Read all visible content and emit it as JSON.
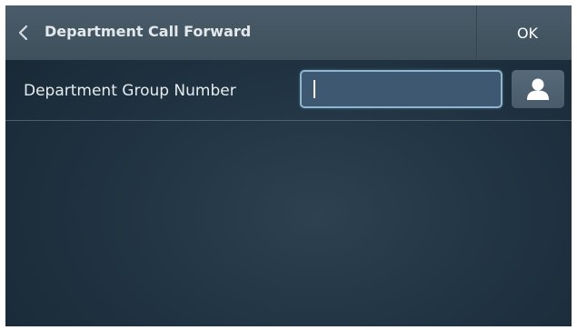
{
  "header": {
    "title": "Department Call Forward",
    "ok_label": "OK"
  },
  "form": {
    "group_number_label": "Department Group Number",
    "group_number_value": ""
  },
  "icons": {
    "back": "chevron-left-icon",
    "contact": "person-icon"
  },
  "colors": {
    "header_bg": "#45576 4",
    "panel_bg": "#213342",
    "input_border": "#8fb6cf",
    "input_bg": "#3f5872",
    "text": "#e6ebee"
  }
}
